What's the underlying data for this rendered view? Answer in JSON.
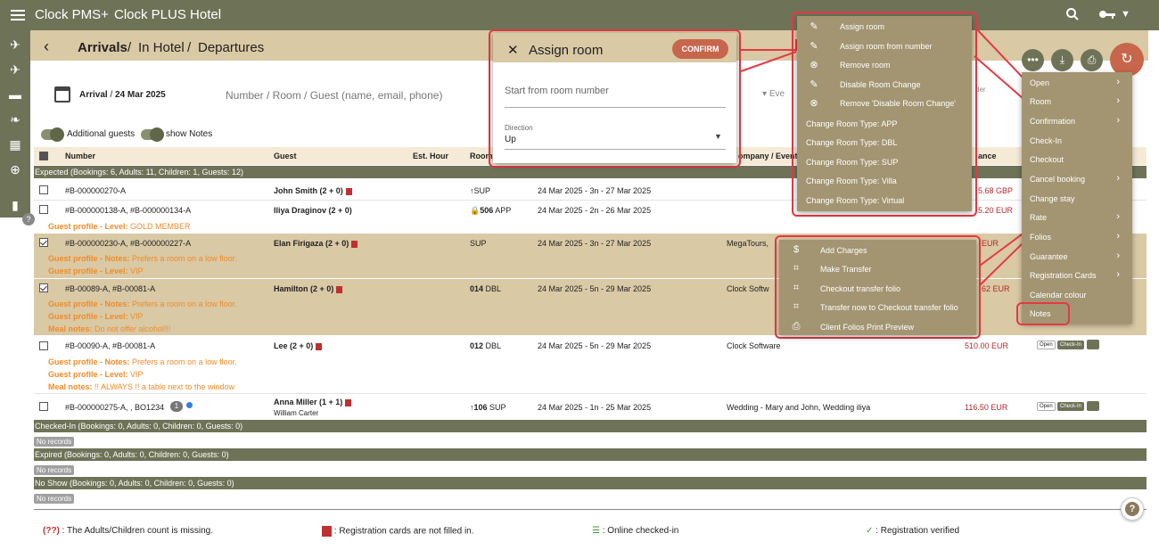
{
  "app": {
    "brand": "Clock PMS+",
    "hotel": "Clock PLUS Hotel"
  },
  "breadcrumb": {
    "arrivals": "Arrivals",
    "sep1": "/",
    "in_hotel": "In Hotel",
    "sep2": "/",
    "departures": "Departures"
  },
  "toolbar": {
    "arrival_label": "Arrival",
    "arrival_date": "24 Mar 2025",
    "search_placeholder": "Number / Room / Guest (name, email, phone)",
    "event_placeholder": "Eve",
    "additional_guests": "Additional guests",
    "show_notes": "show Notes"
  },
  "table": {
    "headers": {
      "number": "Number",
      "guest": "Guest",
      "est_hour": "Est. Hour",
      "room": "Room",
      "company": "ompany / Event",
      "balance": "ance"
    }
  },
  "groups": {
    "expected": "Expected (Bookings: 6, Adults: 11, Children: 1, Guests: 12)",
    "checked_in": "Checked-In (Bookings: 0, Adults: 0, Children: 0, Guests: 0)",
    "expired": "Expired (Bookings: 0, Adults: 0, Children: 0, Guests: 0)",
    "no_show": "No Show (Bookings: 0, Adults: 0, Children: 0, Guests: 0)",
    "no_records": "No records"
  },
  "rows": [
    {
      "number": "#B-000000270-A",
      "guest": "John Smith (2 + 0)",
      "room": "SUP",
      "dates": "24 Mar 2025 - 3n - 27 Mar 2025",
      "company": "",
      "price": "5.68 GBP"
    },
    {
      "number": "#B-000000138-A, #B-000000134-A",
      "guest": "Iliya Draginov (2 + 0)",
      "room_num": "506",
      "room": "APP",
      "dates": "24 Mar 2025 - 2n - 26 Mar 2025",
      "company": "",
      "price": "5.20 EUR",
      "note1_label": "Guest profile - Level:",
      "note1": "GOLD MEMBER"
    },
    {
      "number": "#B-000000230-A, #B-000000227-A",
      "guest": "Elan Firigaza (2 + 0)",
      "room": "SUP",
      "dates": "24 Mar 2025 - 3n - 27 Mar 2025",
      "company": "MegaTours,",
      "price": "EUR",
      "note1_label": "Guest profile - Notes:",
      "note1": "Prefers a room on a low floor.",
      "note2_label": "Guest profile - Level:",
      "note2": "VIP"
    },
    {
      "number": "#B-00089-A, #B-00081-A",
      "guest": "Hamilton (2 + 0)",
      "room_num": "014",
      "room": "DBL",
      "dates": "24 Mar 2025 - 5n - 29 Mar 2025",
      "company": "Clock Softw",
      "price": "62 EUR",
      "note1_label": "Guest profile - Notes:",
      "note1": "Prefers a room on a low floor.",
      "note2_label": "Guest profile - Level:",
      "note2": "VIP",
      "note3_label": "Meal notes:",
      "note3": "Do not offer alcohol!!!"
    },
    {
      "number": "#B-00090-A, #B-00081-A",
      "guest": "Lee (2 + 0)",
      "room_num": "012",
      "room": "DBL",
      "dates": "24 Mar 2025 - 5n - 29 Mar 2025",
      "company": "Clock Software",
      "price": "510.00 EUR",
      "note1_label": "Guest profile - Notes:",
      "note1": "Prefers a room on a low floor.",
      "note2_label": "Guest profile - Level:",
      "note2": "VIP",
      "note3_label": "Meal notes:",
      "note3": "!! ALWAYS !! a table next to the window"
    },
    {
      "number": "#B-000000275-A, , BO1234",
      "badge": "1",
      "guest": "Anna Miller (1 + 1)",
      "guest2": "William Carter",
      "room_num": "106",
      "room": "SUP",
      "dates": "24 Mar 2025 - 1n - 25 Mar 2025",
      "company": "Wedding - Mary and John, Wedding iliya",
      "price": "116.50 EUR"
    }
  ],
  "row_buttons": {
    "open": "Open",
    "checkin": "Check-In"
  },
  "dialog": {
    "title": "Assign room",
    "confirm": "CONFIRM",
    "placeholder": "Start from room number",
    "direction_label": "Direction",
    "direction_value": "Up"
  },
  "room_menu": [
    "Assign room",
    "Assign room from number",
    "Remove room",
    "Disable Room Change",
    "Remove 'Disable Room Change'",
    "Change Room Type: APP",
    "Change Room Type: DBL",
    "Change Room Type: SUP",
    "Change Room Type: Villa",
    "Change Room Type: Virtual"
  ],
  "folio_menu": [
    "Add Charges",
    "Make Transfer",
    "Checkout transfer folio",
    "Transfer now to Checkout transfer folio",
    "Client Folios Print Preview"
  ],
  "main_menu": [
    "Open",
    "Room",
    "Confirmation",
    "Check-In",
    "Checkout",
    "Cancel booking",
    "Change stay",
    "Rate",
    "Folios",
    "Guarantee",
    "Registration Cards",
    "Calendar colour",
    "Notes"
  ],
  "legend": {
    "missing_code": "(??)",
    "missing": ": The Adults/Children count is missing.",
    "regcards": ": Registration cards are not filled in.",
    "online": ": Online checked-in",
    "verified": ": Registration verified"
  },
  "filter_hint": "der",
  "help_char": "?",
  "colors": {
    "primary": "#6e7358",
    "accent": "#c7664b",
    "highlight": "#d9c9a5",
    "menu": "#a39572",
    "outline": "#e53944"
  }
}
